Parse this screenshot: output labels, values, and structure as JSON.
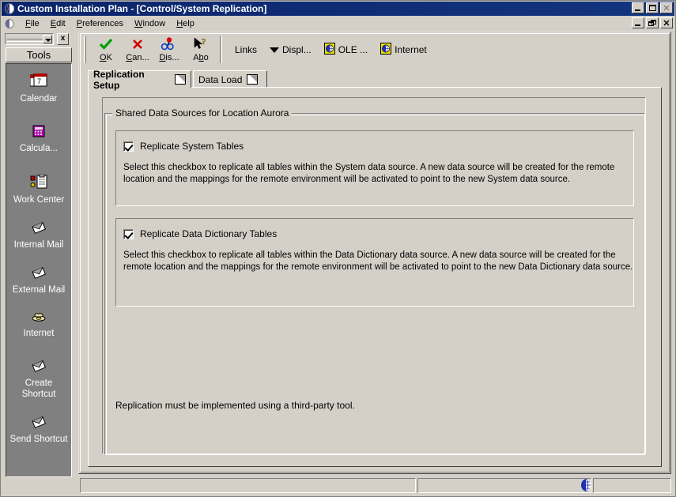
{
  "window": {
    "title": "Custom Installation Plan - [Control/System Replication]",
    "sys_icon": "application-icon",
    "buttons": {
      "minimize": "minimize-button",
      "maximize": "maximize-button",
      "close": "close-button"
    }
  },
  "menubar": {
    "sys_icon": "document-icon",
    "items": [
      {
        "label": "File",
        "accel": "F"
      },
      {
        "label": "Edit",
        "accel": "E"
      },
      {
        "label": "Preferences",
        "accel": "P"
      },
      {
        "label": "Window",
        "accel": "W"
      },
      {
        "label": "Help",
        "accel": "H"
      }
    ],
    "mdi_buttons": {
      "minimize": "mdi-minimize-button",
      "restore": "mdi-restore-button",
      "close": "mdi-close-button"
    }
  },
  "sidebar": {
    "header": {
      "combo_value": "",
      "close_label": "x"
    },
    "title": "Tools",
    "items": [
      {
        "label": "Calendar",
        "icon": "calendar-icon"
      },
      {
        "label": "Calcula...",
        "icon": "calculator-icon"
      },
      {
        "label": "Work Center",
        "icon": "work-center-icon"
      },
      {
        "label": "Internal Mail",
        "icon": "envelope-icon"
      },
      {
        "label": "External Mail",
        "icon": "envelope-icon"
      },
      {
        "label": "Internet",
        "icon": "telephone-icon"
      },
      {
        "label": "Create Shortcut",
        "icon": "envelope-icon"
      },
      {
        "label": "Send Shortcut",
        "icon": "envelope-icon"
      }
    ]
  },
  "toolbar": {
    "buttons": [
      {
        "label": "OK",
        "icon": "green-check-icon",
        "accel": "O"
      },
      {
        "label": "Can...",
        "icon": "red-x-icon",
        "accel": "C"
      },
      {
        "label": "Dis...",
        "icon": "glasses-icon",
        "accel": "D"
      },
      {
        "label": "Abo",
        "icon": "arrow-question-icon",
        "accel": "b"
      }
    ],
    "links_label": "Links",
    "display_label": "Displ...",
    "ole_label": "OLE ...",
    "internet_label": "Internet",
    "ole_icon": "globe-page-icon",
    "internet_icon": "globe-page-icon",
    "dropdown_icon": "chevron-down-icon"
  },
  "tabs": [
    {
      "label": "Replication Setup",
      "active": true,
      "icon": "page-corner-icon"
    },
    {
      "label": "Data Load",
      "active": false,
      "icon": "page-corner-icon"
    }
  ],
  "form": {
    "groupbox_title": "Shared Data Sources for Location Aurora",
    "sections": [
      {
        "checkbox_label": "Replicate System Tables",
        "checked": true,
        "description": "Select this checkbox to replicate all tables within the System data source.  A new data source will be created for the remote location and the mappings for the remote environment will be activated to point to the new System data source."
      },
      {
        "checkbox_label": "Replicate Data Dictionary Tables",
        "checked": true,
        "description": "Select this checkbox to replicate all tables within the Data Dictionary data source.  A new data source will be created for the remote location and the mappings for the remote environment will be activated to point to the new Data Dictionary data source."
      }
    ],
    "footer_note": "Replication must be implemented using a third-party tool."
  },
  "statusbar": {
    "panes": [
      "",
      "",
      ""
    ],
    "globe_icon": "globe-icon"
  },
  "colors": {
    "face": "#d4d0c8",
    "title_active": "#0a246a",
    "sidebar_bg": "#808080",
    "accent_check": "#00a000",
    "accent_x": "#d00000"
  }
}
